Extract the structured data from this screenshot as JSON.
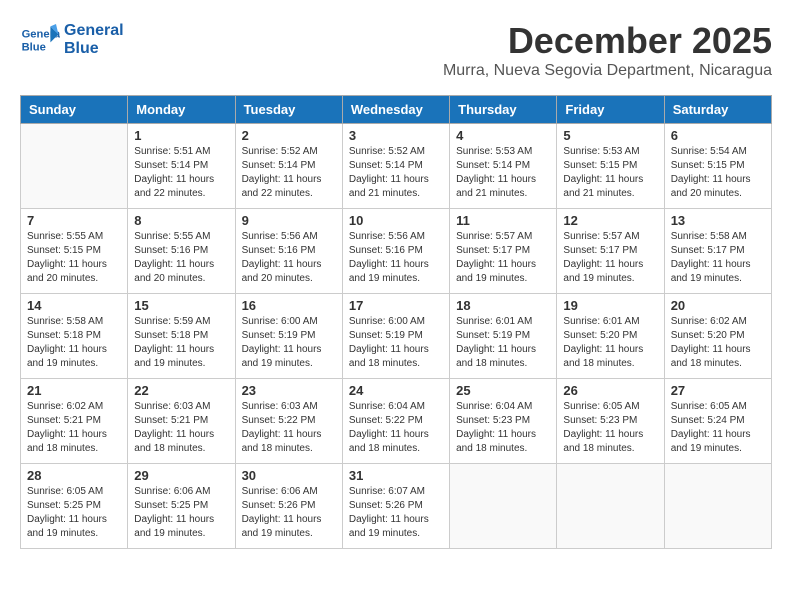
{
  "logo": {
    "text_line1": "General",
    "text_line2": "Blue"
  },
  "header": {
    "month_year": "December 2025",
    "location": "Murra, Nueva Segovia Department, Nicaragua"
  },
  "days_of_week": [
    "Sunday",
    "Monday",
    "Tuesday",
    "Wednesday",
    "Thursday",
    "Friday",
    "Saturday"
  ],
  "weeks": [
    [
      {
        "day": "",
        "info": ""
      },
      {
        "day": "1",
        "info": "Sunrise: 5:51 AM\nSunset: 5:14 PM\nDaylight: 11 hours\nand 22 minutes."
      },
      {
        "day": "2",
        "info": "Sunrise: 5:52 AM\nSunset: 5:14 PM\nDaylight: 11 hours\nand 22 minutes."
      },
      {
        "day": "3",
        "info": "Sunrise: 5:52 AM\nSunset: 5:14 PM\nDaylight: 11 hours\nand 21 minutes."
      },
      {
        "day": "4",
        "info": "Sunrise: 5:53 AM\nSunset: 5:14 PM\nDaylight: 11 hours\nand 21 minutes."
      },
      {
        "day": "5",
        "info": "Sunrise: 5:53 AM\nSunset: 5:15 PM\nDaylight: 11 hours\nand 21 minutes."
      },
      {
        "day": "6",
        "info": "Sunrise: 5:54 AM\nSunset: 5:15 PM\nDaylight: 11 hours\nand 20 minutes."
      }
    ],
    [
      {
        "day": "7",
        "info": "Sunrise: 5:55 AM\nSunset: 5:15 PM\nDaylight: 11 hours\nand 20 minutes."
      },
      {
        "day": "8",
        "info": "Sunrise: 5:55 AM\nSunset: 5:16 PM\nDaylight: 11 hours\nand 20 minutes."
      },
      {
        "day": "9",
        "info": "Sunrise: 5:56 AM\nSunset: 5:16 PM\nDaylight: 11 hours\nand 20 minutes."
      },
      {
        "day": "10",
        "info": "Sunrise: 5:56 AM\nSunset: 5:16 PM\nDaylight: 11 hours\nand 19 minutes."
      },
      {
        "day": "11",
        "info": "Sunrise: 5:57 AM\nSunset: 5:17 PM\nDaylight: 11 hours\nand 19 minutes."
      },
      {
        "day": "12",
        "info": "Sunrise: 5:57 AM\nSunset: 5:17 PM\nDaylight: 11 hours\nand 19 minutes."
      },
      {
        "day": "13",
        "info": "Sunrise: 5:58 AM\nSunset: 5:17 PM\nDaylight: 11 hours\nand 19 minutes."
      }
    ],
    [
      {
        "day": "14",
        "info": "Sunrise: 5:58 AM\nSunset: 5:18 PM\nDaylight: 11 hours\nand 19 minutes."
      },
      {
        "day": "15",
        "info": "Sunrise: 5:59 AM\nSunset: 5:18 PM\nDaylight: 11 hours\nand 19 minutes."
      },
      {
        "day": "16",
        "info": "Sunrise: 6:00 AM\nSunset: 5:19 PM\nDaylight: 11 hours\nand 19 minutes."
      },
      {
        "day": "17",
        "info": "Sunrise: 6:00 AM\nSunset: 5:19 PM\nDaylight: 11 hours\nand 18 minutes."
      },
      {
        "day": "18",
        "info": "Sunrise: 6:01 AM\nSunset: 5:19 PM\nDaylight: 11 hours\nand 18 minutes."
      },
      {
        "day": "19",
        "info": "Sunrise: 6:01 AM\nSunset: 5:20 PM\nDaylight: 11 hours\nand 18 minutes."
      },
      {
        "day": "20",
        "info": "Sunrise: 6:02 AM\nSunset: 5:20 PM\nDaylight: 11 hours\nand 18 minutes."
      }
    ],
    [
      {
        "day": "21",
        "info": "Sunrise: 6:02 AM\nSunset: 5:21 PM\nDaylight: 11 hours\nand 18 minutes."
      },
      {
        "day": "22",
        "info": "Sunrise: 6:03 AM\nSunset: 5:21 PM\nDaylight: 11 hours\nand 18 minutes."
      },
      {
        "day": "23",
        "info": "Sunrise: 6:03 AM\nSunset: 5:22 PM\nDaylight: 11 hours\nand 18 minutes."
      },
      {
        "day": "24",
        "info": "Sunrise: 6:04 AM\nSunset: 5:22 PM\nDaylight: 11 hours\nand 18 minutes."
      },
      {
        "day": "25",
        "info": "Sunrise: 6:04 AM\nSunset: 5:23 PM\nDaylight: 11 hours\nand 18 minutes."
      },
      {
        "day": "26",
        "info": "Sunrise: 6:05 AM\nSunset: 5:23 PM\nDaylight: 11 hours\nand 18 minutes."
      },
      {
        "day": "27",
        "info": "Sunrise: 6:05 AM\nSunset: 5:24 PM\nDaylight: 11 hours\nand 19 minutes."
      }
    ],
    [
      {
        "day": "28",
        "info": "Sunrise: 6:05 AM\nSunset: 5:25 PM\nDaylight: 11 hours\nand 19 minutes."
      },
      {
        "day": "29",
        "info": "Sunrise: 6:06 AM\nSunset: 5:25 PM\nDaylight: 11 hours\nand 19 minutes."
      },
      {
        "day": "30",
        "info": "Sunrise: 6:06 AM\nSunset: 5:26 PM\nDaylight: 11 hours\nand 19 minutes."
      },
      {
        "day": "31",
        "info": "Sunrise: 6:07 AM\nSunset: 5:26 PM\nDaylight: 11 hours\nand 19 minutes."
      },
      {
        "day": "",
        "info": ""
      },
      {
        "day": "",
        "info": ""
      },
      {
        "day": "",
        "info": ""
      }
    ]
  ]
}
